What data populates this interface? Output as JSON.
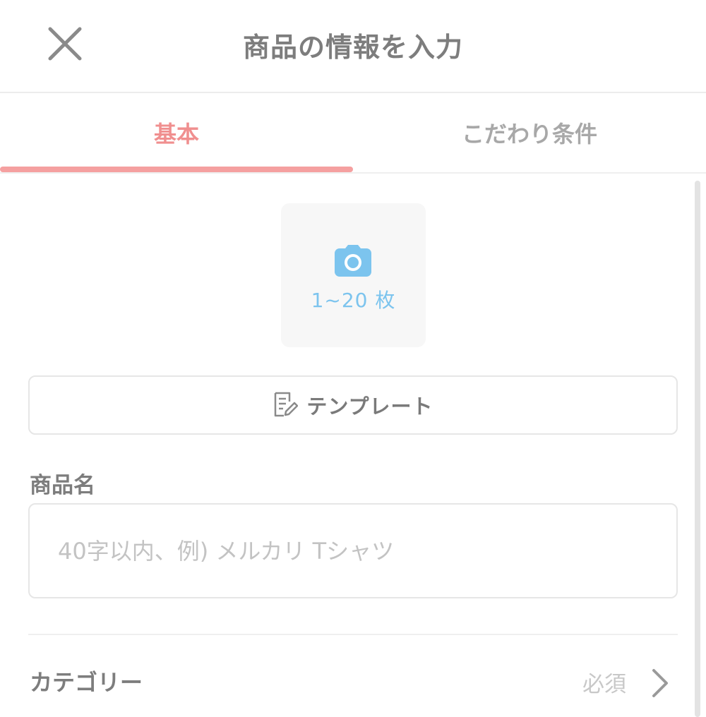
{
  "header": {
    "title": "商品の情報を入力"
  },
  "tabs": [
    {
      "label": "基本"
    },
    {
      "label": "こだわり条件"
    }
  ],
  "photo": {
    "count_label": "1~20 枚"
  },
  "template": {
    "label": "テンプレート"
  },
  "product_name": {
    "label": "商品名",
    "placeholder": "40字以内、例) メルカリ Tシャツ",
    "value": ""
  },
  "category": {
    "label": "カテゴリー",
    "required": "必須"
  },
  "colors": {
    "accent": "#f5a0a0",
    "camera": "#7cc4ee"
  }
}
